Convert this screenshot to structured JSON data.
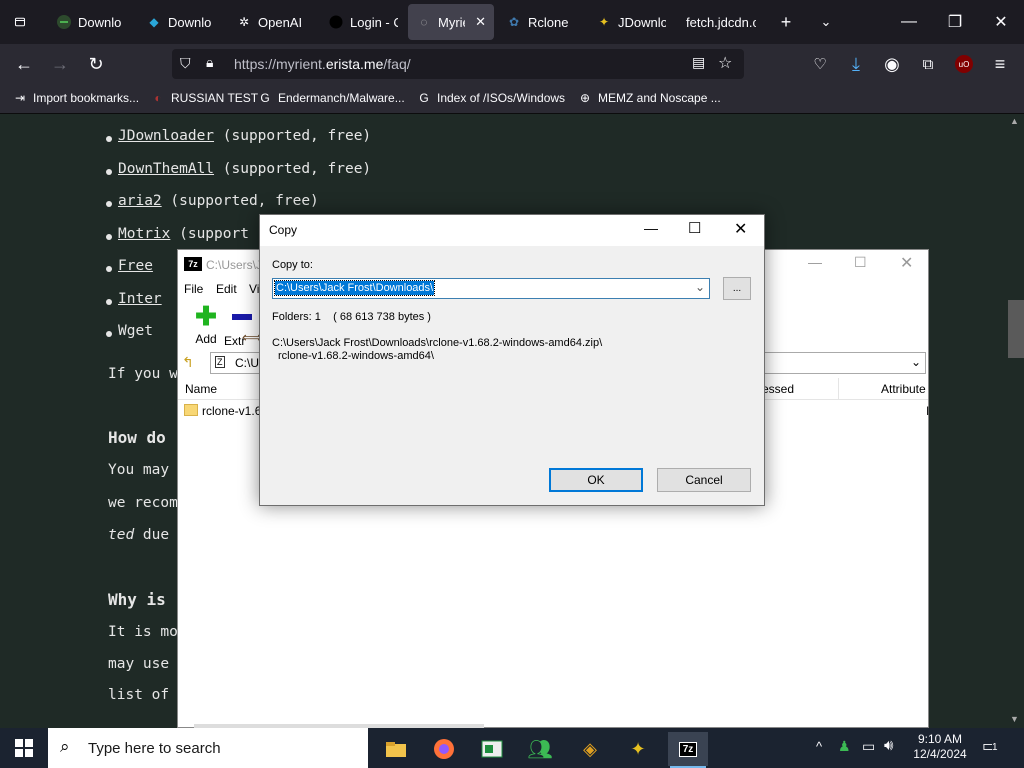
{
  "browser": {
    "tabs": [
      {
        "label": "Downlo",
        "icon": "download-site-icon",
        "active": false
      },
      {
        "label": "Downlo",
        "icon": "download-arrow-icon",
        "active": false
      },
      {
        "label": "OpenAI",
        "icon": "openai-icon",
        "active": false
      },
      {
        "label": "Login - C",
        "icon": "github-icon",
        "active": false
      },
      {
        "label": "Myrie",
        "icon": "loading-icon",
        "active": true
      },
      {
        "label": "Rclone",
        "icon": "rclone-icon",
        "active": false
      },
      {
        "label": "JDownlo",
        "icon": "jdownloader-icon",
        "active": false
      },
      {
        "label": "fetch.jdcdn.c",
        "icon": "",
        "active": false
      }
    ],
    "url_prefix": "https://myrient.",
    "url_domain": "erista.me",
    "url_path": "/faq/",
    "bookmarks": [
      {
        "label": "Import bookmarks...",
        "icon": "import-icon"
      },
      {
        "label": "RUSSIAN TEST",
        "icon": "site-icon"
      },
      {
        "label": "Endermanch/Malware...",
        "icon": "google-icon"
      },
      {
        "label": "Index of /ISOs/Windows",
        "icon": "google-icon"
      },
      {
        "label": "MEMZ and Noscape ...",
        "icon": "globe-icon"
      }
    ],
    "extension_badge": "uO"
  },
  "page": {
    "list_items": [
      {
        "link": "JDownloader",
        "rest": " (supported, free)"
      },
      {
        "link": "DownThemAll",
        "rest": " (supported, free)"
      },
      {
        "link": "aria2",
        "rest": " (supported, free)"
      },
      {
        "link": "Motrix",
        "rest": " (support"
      },
      {
        "link": "Free",
        "rest": ""
      },
      {
        "link": "Inter",
        "rest": ""
      },
      {
        "link": "",
        "rest": "Wget"
      }
    ],
    "line_if_you": "If you w",
    "heading_how": "How do",
    "line_you_may": "You may",
    "line_we_recom": "we recom",
    "line_ted_due_em": "ted",
    "line_ted_due_rest": " due",
    "heading_why": "Why is",
    "line_it_is": "It is mo",
    "line_may_use": "may use",
    "line_list_of": "list of"
  },
  "zip_window": {
    "title": "C:\\Users\\J",
    "menu": [
      "File",
      "Edit",
      "Vi"
    ],
    "toolbar_add": "Add",
    "toolbar_extract": "Extr",
    "path": "C:\\U",
    "col_name": "Name",
    "col_compressed": "essed",
    "col_attributes": "Attribute",
    "row_name": "rclone-v1.6",
    "row_attr": "I"
  },
  "copy_dialog": {
    "title": "Copy",
    "copy_to_label": "Copy to:",
    "copy_to_value": "C:\\Users\\Jack Frost\\Downloads\\",
    "browse_label": "...",
    "folders_info": "Folders: 1    ( 68 613 738 bytes )",
    "source_line1": "C:\\Users\\Jack Frost\\Downloads\\rclone-v1.68.2-windows-amd64.zip\\",
    "source_line2": "rclone-v1.68.2-windows-amd64\\",
    "ok_label": "OK",
    "cancel_label": "Cancel"
  },
  "taskbar": {
    "search_placeholder": "Type here to search",
    "time": "9:10 AM",
    "date": "12/4/2024",
    "notification_count": "1"
  }
}
